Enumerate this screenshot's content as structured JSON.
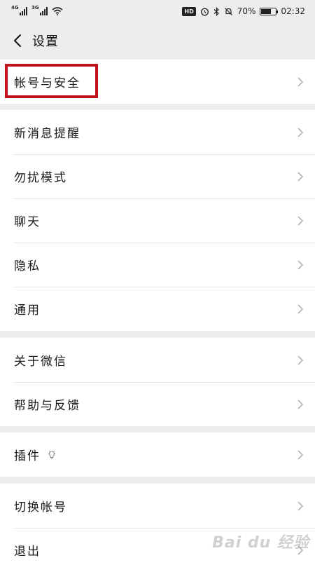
{
  "status_bar": {
    "signal_1_label": "4G",
    "signal_2_label": "3G",
    "hd_label": "HD",
    "battery_percent": "70%",
    "battery_level": 0.7,
    "time": "02:32"
  },
  "header": {
    "title": "设置",
    "back_icon": "chevron-left-icon"
  },
  "groups": [
    {
      "items": [
        {
          "label": "帐号与安全"
        }
      ]
    },
    {
      "items": [
        {
          "label": "新消息提醒"
        },
        {
          "label": "勿扰模式"
        },
        {
          "label": "聊天"
        },
        {
          "label": "隐私"
        },
        {
          "label": "通用"
        }
      ]
    },
    {
      "items": [
        {
          "label": "关于微信"
        },
        {
          "label": "帮助与反馈"
        }
      ]
    },
    {
      "items": [
        {
          "label": "插件"
        }
      ]
    },
    {
      "items": [
        {
          "label": "切换帐号"
        },
        {
          "label": "退出"
        }
      ]
    }
  ],
  "watermark": "Bai du 经验",
  "colors": {
    "background": "#ededed",
    "row_background": "#ffffff",
    "highlight_border": "#c0151e",
    "chevron": "#b2b2b2"
  }
}
